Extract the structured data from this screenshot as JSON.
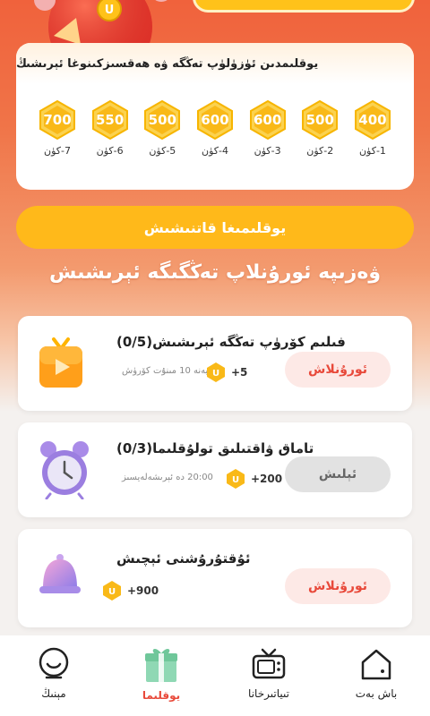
{
  "checkin": {
    "title": "يوقلىمدىن ئۈزۈلۈپ تەڭگە ۋە ھەقسىزكىنوغا ئېرىشىڭ",
    "days": [
      {
        "label": "1-كۈن",
        "value": "400"
      },
      {
        "label": "2-كۈن",
        "value": "500"
      },
      {
        "label": "3-كۈن",
        "value": "600"
      },
      {
        "label": "4-كۈن",
        "value": "600"
      },
      {
        "label": "5-كۈن",
        "value": "500"
      },
      {
        "label": "6-كۈن",
        "value": "550"
      },
      {
        "label": "7-كۈن",
        "value": "700"
      }
    ]
  },
  "banner": {
    "label": "يوقلىمىغا قاتنىشىش"
  },
  "section_title": "ۋەزىپە ئورۇنلاپ تەڭگىگە ئېرىشىش",
  "tasks": [
    {
      "title": "فىلىم كۆرۈپ تەڭگە ئېرىشىش(0/5)",
      "reward": "+5",
      "note": "يەنە 10 مىنۇت كۆرۈش",
      "button": "ئورۇنلاش",
      "button_state": "go"
    },
    {
      "title": "تاماق ۋاقتىلىق تولۇقلىما(0/3)",
      "reward": "+200",
      "note": "20:00 دە ئېرىشەلەيسىز",
      "button": "ئېلىش",
      "button_state": "done"
    },
    {
      "title": "ئۇقتۇرۇشنى ئېچىش",
      "reward": "+900",
      "note": "",
      "button": "ئورۇنلاش",
      "button_state": "go"
    }
  ],
  "tabs": [
    {
      "label": "باش بەت",
      "icon": "home-icon"
    },
    {
      "label": "تىياتىرخانا",
      "icon": "tv-icon"
    },
    {
      "label": "يوقلىما",
      "icon": "gift-icon",
      "active": true
    },
    {
      "label": "مېنىڭ",
      "icon": "profile-icon"
    }
  ],
  "colors": {
    "accent": "#e8493a",
    "gold": "#ffc21a",
    "coin": "#f7b500"
  }
}
